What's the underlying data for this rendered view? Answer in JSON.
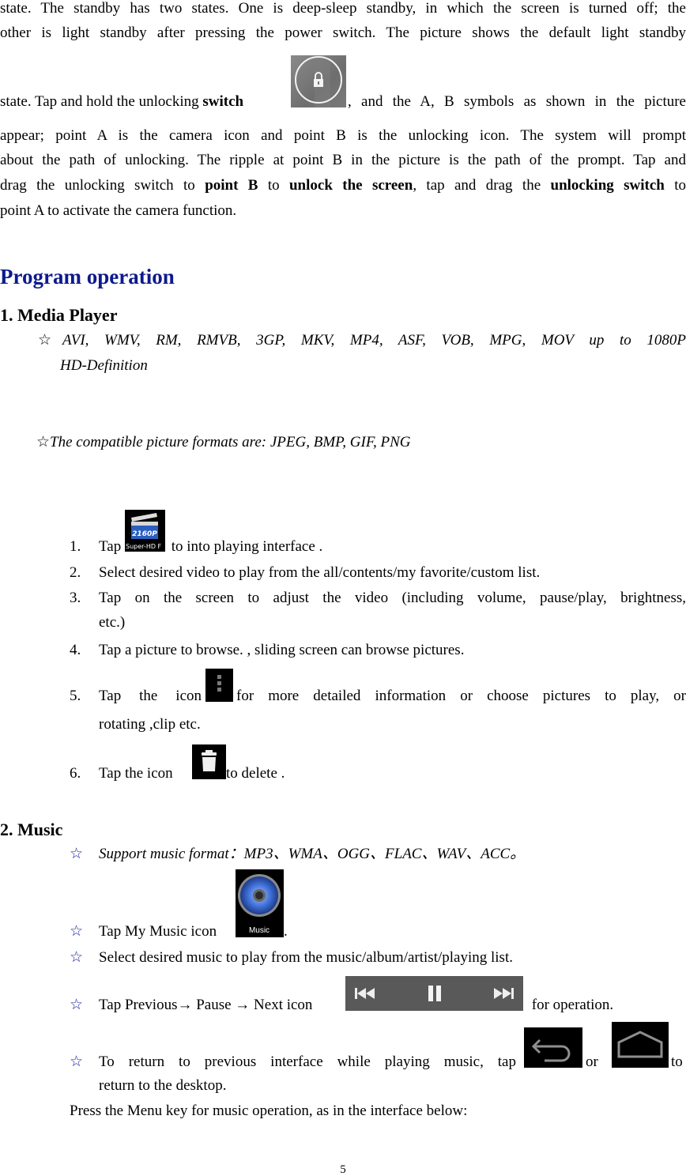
{
  "intro": {
    "line1": "state. The standby has two states. One is deep-sleep standby, in which the screen is turned off; the",
    "line2": "other is light standby after pressing the power switch. The picture shows the default light standby",
    "line3_a": "state. Tap and hold the unlocking ",
    "line3_bold": "switch",
    "line3_b": ", and the A, B symbols as shown in the picture",
    "line4": "appear; point A is the camera icon and point B is the unlocking icon. The system will prompt",
    "line5": "about the path of unlocking. The ripple at point B in the picture is the path of the prompt. Tap and",
    "line6_a": "drag the unlocking switch to ",
    "line6_bold1": "point B",
    "line6_b": " to ",
    "line6_bold2": "unlock the screen",
    "line6_c": ", tap and drag the ",
    "line6_bold3": "unlocking switch",
    "line6_d": " to",
    "line7": "point A to activate the camera function.",
    "lock_icon": "lock-icon"
  },
  "section_title": "Program operation",
  "media_player": {
    "heading": "1. Media Player",
    "star": "☆",
    "video_formats_line1": "AVI, WMV, RM, RMVB, 3GP, MKV, MP4, ASF, VOB, MPG, MOV up to 1080P",
    "video_formats_line2": "HD-Definition",
    "picture_formats": "The compatible picture formats are: JPEG, BMP, GIF, PNG",
    "app_icon": {
      "name": "super-hd-player-icon",
      "badge": "2160P",
      "label": "Super-HD F"
    },
    "steps": [
      {
        "num": "1.",
        "a": "Tap",
        "b": " to into playing interface ."
      },
      {
        "num": "2.",
        "text": "Select desired video to play from the all/contents/my favorite/custom list."
      },
      {
        "num": "3.",
        "line1": "Tap on the screen to adjust the video (including volume, pause/play, brightness,",
        "line2": "etc.)"
      },
      {
        "num": "4.",
        "text": "Tap a picture to browse. , sliding screen can browse pictures."
      },
      {
        "num": "5.",
        "a": "Tap the icon ",
        "b": "for more detailed information or choose pictures to play, or",
        "line2": "rotating ,clip etc.",
        "icon": "overflow-menu-icon"
      },
      {
        "num": "6.",
        "a": "Tap the icon ",
        "b": "to delete .",
        "icon": "trash-icon"
      }
    ]
  },
  "music": {
    "heading": "2. Music",
    "star": "☆",
    "formats": "Support music format：MP3、WMA、OGG、FLAC、WAV、ACC。",
    "items": [
      {
        "a": "Tap My Music icon",
        "b": ".",
        "icon_label": "Music"
      },
      {
        "text": "Select desired music to play from the music/album/artist/playing list."
      },
      {
        "a": "Tap Previous→ Pause → Next icon",
        "b": " for operation."
      },
      {
        "a": "To return to previous interface while playing music, tap",
        "or": "or",
        "to": "to",
        "line2": "return to the desktop."
      }
    ],
    "menu_note": "Press the Menu key for music operation, as in the interface below:"
  },
  "colors": {
    "heading_blue": "#0d1a8c",
    "star_blue": "#1c1c9c"
  },
  "page_number": "5"
}
